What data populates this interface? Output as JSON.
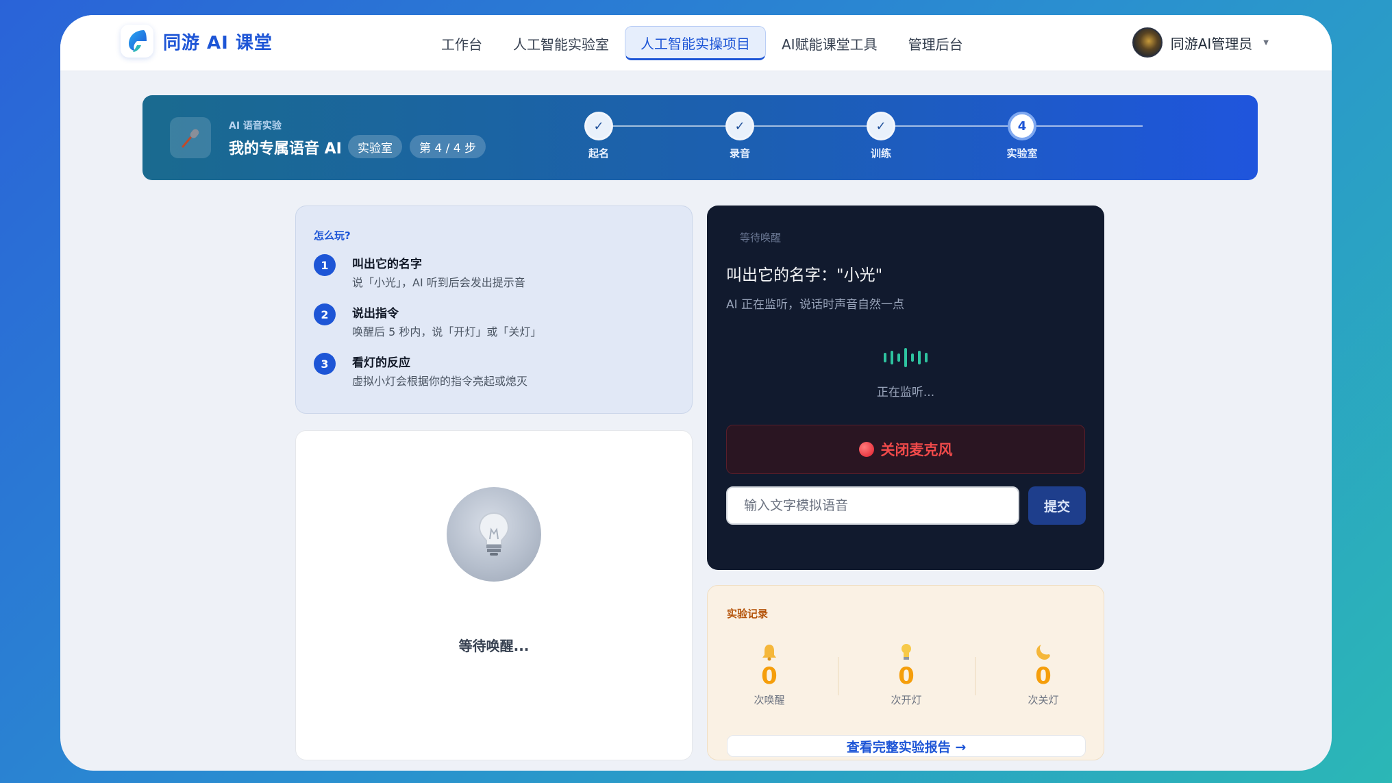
{
  "header": {
    "logo_text": "同游 AI 课堂",
    "nav": [
      {
        "label": "工作台"
      },
      {
        "label": "人工智能实验室"
      },
      {
        "label": "人工智能实操项目"
      },
      {
        "label": "AI赋能课堂工具"
      },
      {
        "label": "管理后台"
      }
    ],
    "active_nav": "人工智能实操项目",
    "user_name": "同游AI管理员"
  },
  "banner": {
    "subtitle": "AI 语音实验",
    "title": "我的专属语音 AI",
    "tag": "实验室",
    "progress": "第 4 / 4 步",
    "steps": [
      {
        "label": "起名",
        "state": "done"
      },
      {
        "label": "录音",
        "state": "done"
      },
      {
        "label": "训练",
        "state": "done"
      },
      {
        "label": "实验室",
        "state": "current",
        "number": "4"
      }
    ]
  },
  "howto": {
    "title": "怎么玩?",
    "items": [
      {
        "num": "1",
        "title": "叫出它的名字",
        "desc": "说「小光」，AI 听到后会发出提示音"
      },
      {
        "num": "2",
        "title": "说出指令",
        "desc": "唤醒后 5 秒内，说「开灯」或「关灯」"
      },
      {
        "num": "3",
        "title": "看灯的反应",
        "desc": "虚拟小灯会根据你的指令亮起或熄灭"
      }
    ]
  },
  "lamp": {
    "status": "等待唤醒..."
  },
  "voice": {
    "status": "等待唤醒",
    "title": "叫出它的名字：\"小光\"",
    "desc": "AI 正在监听，说话时声音自然一点",
    "listening": "正在监听...",
    "mic_button": "关闭麦克风",
    "input_placeholder": "输入文字模拟语音",
    "submit": "提交"
  },
  "record": {
    "title": "实验记录",
    "stats": [
      {
        "icon": "bell-icon",
        "value": "0",
        "label": "次唤醒"
      },
      {
        "icon": "bulb-icon",
        "value": "0",
        "label": "次开灯"
      },
      {
        "icon": "moon-icon",
        "value": "0",
        "label": "次关灯"
      }
    ],
    "report_button": "查看完整实验报告 →"
  },
  "colors": {
    "accent": "#1d55d6",
    "dark_panel": "#111a2e",
    "wave": "#2ec4a0",
    "danger": "#f04a4a",
    "stat": "#f59e0b"
  }
}
